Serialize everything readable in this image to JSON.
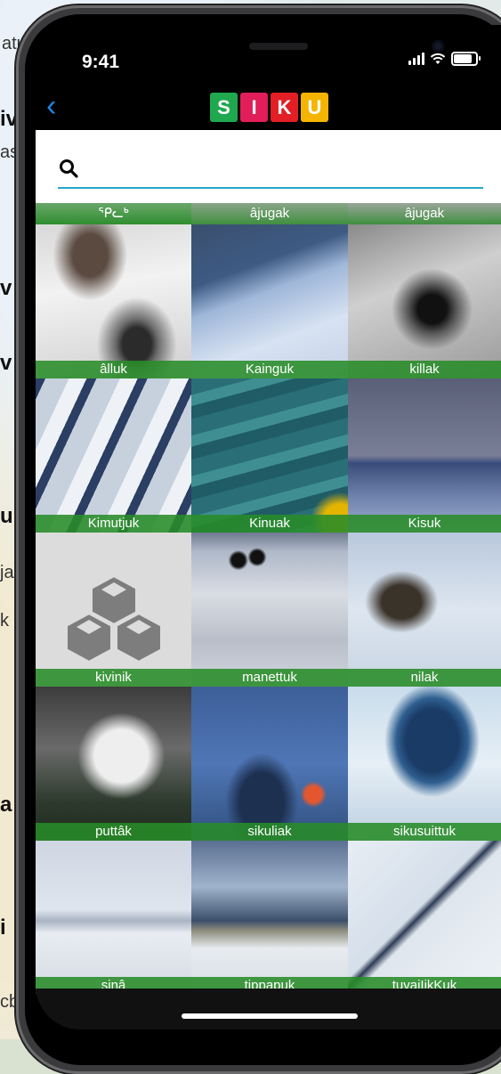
{
  "background_map": {
    "labels": [
      "atua",
      "iv",
      "as",
      "a",
      "v",
      "v",
      "u",
      "ja",
      "k",
      "a",
      "i",
      "cb"
    ]
  },
  "status_bar": {
    "time": "9:41"
  },
  "nav": {
    "back_label": "‹",
    "logo_letters": [
      "S",
      "I",
      "K",
      "U"
    ],
    "logo_colors": [
      "#1fa84f",
      "#e11e5a",
      "#e31e24",
      "#f5b400"
    ]
  },
  "search": {
    "value": "",
    "placeholder": ""
  },
  "grid": {
    "top_captions": [
      "ᕿᓚᒃ",
      "âjugak",
      "âjugak"
    ],
    "tiles": [
      {
        "caption": "âlluk"
      },
      {
        "caption": "Kainguk"
      },
      {
        "caption": "killak"
      },
      {
        "caption": "Kimutjuk"
      },
      {
        "caption": "Kinuak"
      },
      {
        "caption": "Kisuk"
      },
      {
        "caption": "kivinik"
      },
      {
        "caption": "manettuk"
      },
      {
        "caption": "nilak"
      },
      {
        "caption": "puttâk"
      },
      {
        "caption": "sikuliak"
      },
      {
        "caption": "sikusuittuk"
      },
      {
        "caption": "sinâ"
      },
      {
        "caption": "tippapuk"
      },
      {
        "caption": "tuvaiIikKuk"
      }
    ]
  },
  "colors": {
    "accent": "#26a6c9",
    "caption_bg": "#288c28",
    "back": "#1e88e5"
  }
}
